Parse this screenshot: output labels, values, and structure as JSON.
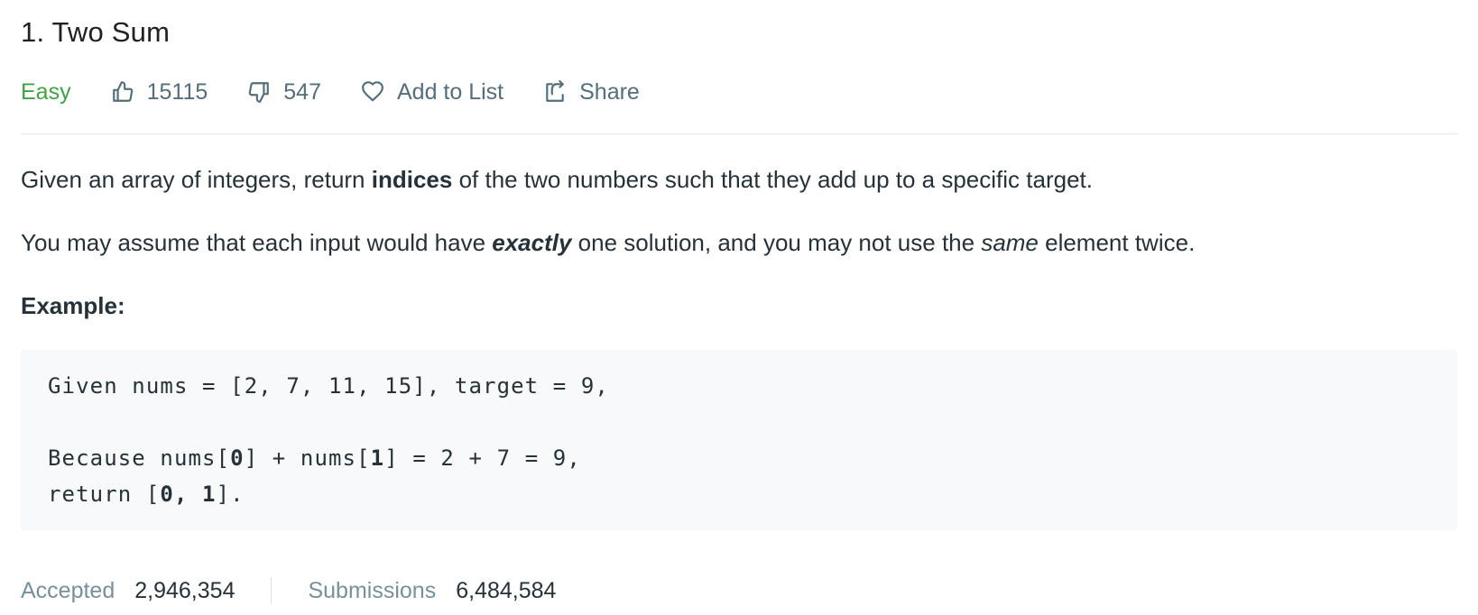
{
  "problem": {
    "title": "1. Two Sum",
    "difficulty": "Easy",
    "likes": "15115",
    "dislikes": "547",
    "add_to_list_label": "Add to List",
    "share_label": "Share"
  },
  "description": {
    "p1_before": "Given an array of integers, return ",
    "p1_bold": "indices",
    "p1_after": " of the two numbers such that they add up to a specific target.",
    "p2_before": "You may assume that each input would have ",
    "p2_bold_italic": "exactly",
    "p2_middle": " one solution, and you may not use the ",
    "p2_italic": "same",
    "p2_after": " element twice.",
    "example_label": "Example:"
  },
  "example_code": {
    "line1": "Given nums = [2, 7, 11, 15], target = 9,",
    "line2_a": "Because nums[",
    "line2_b": "0",
    "line2_c": "] + nums[",
    "line2_d": "1",
    "line2_e": "] = 2 + 7 = 9,",
    "line3_a": "return [",
    "line3_b": "0, 1",
    "line3_c": "]."
  },
  "stats": {
    "accepted_label": "Accepted",
    "accepted_value": "2,946,354",
    "submissions_label": "Submissions",
    "submissions_value": "6,484,584"
  },
  "colors": {
    "difficulty_easy": "#43a047",
    "text_primary": "#263238",
    "text_muted": "#546e7a",
    "code_background": "#f7f9fa"
  },
  "icons": {
    "like": "thumbs-up-icon",
    "dislike": "thumbs-down-icon",
    "add_to_list": "heart-icon",
    "share": "share-icon"
  }
}
